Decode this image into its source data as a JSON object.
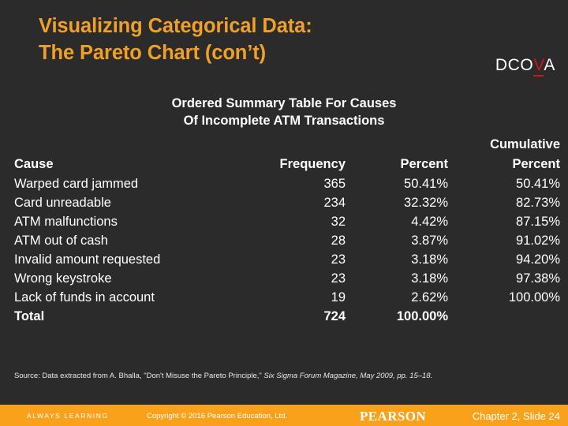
{
  "slide": {
    "title_line1": "Visualizing Categorical Data:",
    "title_line2": "The Pareto Chart (con’t)",
    "title_color": "#f0a024",
    "background_color": "#2b2b2b"
  },
  "badge": {
    "prefix": "DCO",
    "highlight": "V",
    "suffix": "A",
    "highlight_color": "#d01515"
  },
  "table": {
    "caption_line1": "Ordered Summary Table For Causes",
    "caption_line2": "Of Incomplete ATM Transactions",
    "header_top": {
      "cause": "",
      "frequency": "",
      "percent": "",
      "cumulative": "Cumulative"
    },
    "headers": {
      "cause": "Cause",
      "frequency": "Frequency",
      "percent": "Percent",
      "cumulative_percent": "Percent"
    },
    "rows": [
      {
        "cause": "Warped card jammed",
        "frequency": "365",
        "percent": "50.41%",
        "cumulative": "50.41%"
      },
      {
        "cause": "Card unreadable",
        "frequency": "234",
        "percent": "32.32%",
        "cumulative": "82.73%"
      },
      {
        "cause": "ATM malfunctions",
        "frequency": "32",
        "percent": "4.42%",
        "cumulative": "87.15%"
      },
      {
        "cause": "ATM out of cash",
        "frequency": "28",
        "percent": "3.87%",
        "cumulative": "91.02%"
      },
      {
        "cause": "Invalid amount requested",
        "frequency": "23",
        "percent": "3.18%",
        "cumulative": "94.20%"
      },
      {
        "cause": "Wrong keystroke",
        "frequency": "23",
        "percent": "3.18%",
        "cumulative": "97.38%"
      },
      {
        "cause": "Lack of funds in account",
        "frequency": "19",
        "percent": "2.62%",
        "cumulative": "100.00%"
      }
    ],
    "total": {
      "cause": "Total",
      "frequency": "724",
      "percent": "100.00%",
      "cumulative": ""
    }
  },
  "source": {
    "plain": "Source: Data extracted from A. Bhalla, \"Don't Misuse the Pareto Principle,\" ",
    "italic": "Six Sigma Forum Magazine, May 2009, pp. 15–18."
  },
  "footer": {
    "always_learning": "ALWAYS LEARNING",
    "copyright": "Copyright © 2016 Pearson Education, Ltd.",
    "brand": "PEARSON",
    "slide_ref": "Chapter 2, Slide 24",
    "bar_color": "#f9a11b"
  },
  "chart_data": {
    "type": "table",
    "title": "Ordered Summary Table For Causes Of Incomplete ATM Transactions",
    "columns": [
      "Cause",
      "Frequency",
      "Percent",
      "Cumulative Percent"
    ],
    "categories": [
      "Warped card jammed",
      "Card unreadable",
      "ATM malfunctions",
      "ATM out of cash",
      "Invalid amount requested",
      "Wrong keystroke",
      "Lack of funds in account"
    ],
    "series": [
      {
        "name": "Frequency",
        "values": [
          365,
          234,
          32,
          28,
          23,
          23,
          19
        ]
      },
      {
        "name": "Percent",
        "values": [
          50.41,
          32.32,
          4.42,
          3.87,
          3.18,
          3.18,
          2.62
        ]
      },
      {
        "name": "Cumulative Percent",
        "values": [
          50.41,
          82.73,
          87.15,
          91.02,
          94.2,
          97.38,
          100.0
        ]
      }
    ],
    "totals": {
      "Frequency": 724,
      "Percent": 100.0
    },
    "xlabel": "Cause",
    "ylabel": "Frequency",
    "ylim": [
      0,
      400
    ]
  }
}
